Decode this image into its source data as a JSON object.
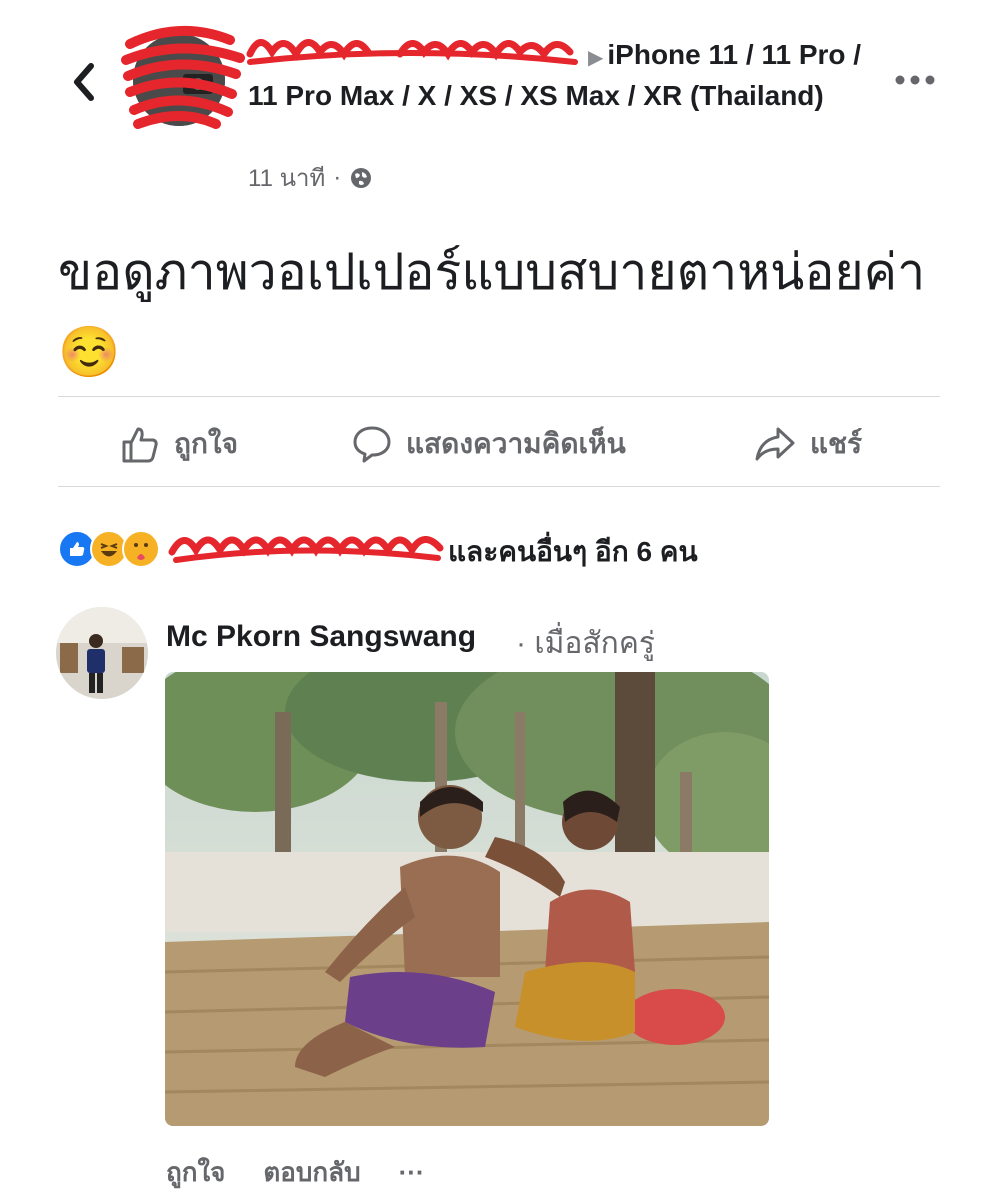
{
  "header": {
    "back_icon": "chevron-left-icon",
    "group_breadcrumb": "iPhone 11 / 11 Pro / 11 Pro Max / X / XS / XS Max / XR (Thailand)",
    "breadcrumb_arrow": "▶",
    "timestamp": "11 นาที",
    "separator": "·",
    "privacy_icon": "globe-icon",
    "more_icon": "more-horizontal-icon"
  },
  "post": {
    "text": "ขอดูภาพวอเปเปอร์แบบสบายตาหน่อยค่า ☺️"
  },
  "actions": {
    "like_label": "ถูกใจ",
    "comment_label": "แสดงความคิดเห็น",
    "share_label": "แชร์"
  },
  "reactions": {
    "icons": [
      "like-reaction-icon",
      "haha-reaction-icon",
      "care-reaction-icon"
    ],
    "summary_suffix": "และคนอื่นๆ อีก 6 คน"
  },
  "comment": {
    "author": "Mc Pkorn Sangswang",
    "time": "· เมื่อสักครู่",
    "like_label": "ถูกใจ",
    "reply_label": "ตอบกลับ",
    "more_label": "···"
  },
  "colors": {
    "text_primary": "#1c1e21",
    "text_secondary": "#65676b",
    "divider": "#d8d9dc",
    "like_blue": "#1877f2",
    "redaction_red": "#e5262c"
  }
}
